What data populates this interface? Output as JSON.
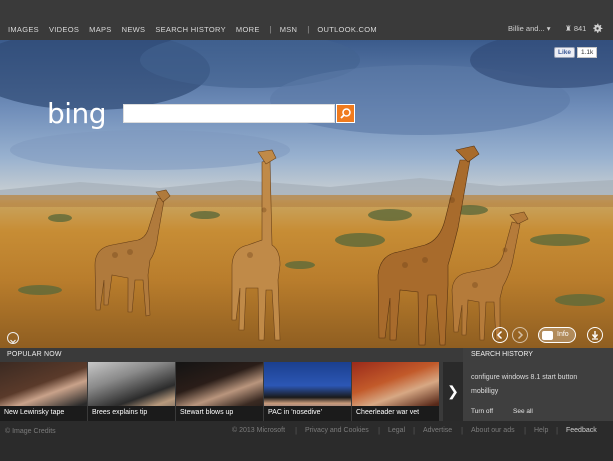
{
  "nav": {
    "items": [
      "IMAGES",
      "VIDEOS",
      "MAPS",
      "NEWS",
      "SEARCH HISTORY",
      "MORE"
    ],
    "msn": "MSN",
    "outlook": "OUTLOOK.COM",
    "user": "Billie and... ▾",
    "rewards": "841"
  },
  "facebook": {
    "like": "Like",
    "count": "1.1k"
  },
  "logo": "bing",
  "search": {
    "value": "",
    "placeholder": ""
  },
  "hero": {
    "info_label": "Info"
  },
  "popular": {
    "title": "POPULAR NOW",
    "tiles": [
      "New Lewinsky tape",
      "Brees explains tip",
      "Stewart blows up",
      "PAC in 'nosedive'",
      "Cheerleader war vet"
    ]
  },
  "history": {
    "title": "SEARCH HISTORY",
    "items": [
      "configure windows 8.1 start button",
      "mobilligy"
    ],
    "turn_off": "Turn off",
    "see_all": "See all"
  },
  "footer": {
    "credits": "© Image Credits",
    "copyright": "© 2013 Microsoft",
    "privacy": "Privacy and Cookies",
    "legal": "Legal",
    "advertise": "Advertise",
    "about_ads": "About our ads",
    "help": "Help",
    "feedback": "Feedback"
  },
  "colors": {
    "accent": "#f07b1e",
    "topbar": "#3a3a3a",
    "panel": "#3a3a3a"
  }
}
